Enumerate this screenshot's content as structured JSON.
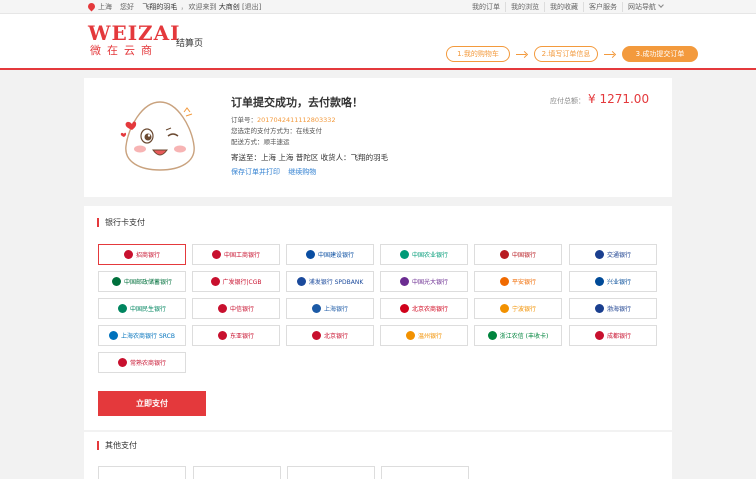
{
  "topbar": {
    "location": "上海",
    "greeting": "您好",
    "username": "飞翔的羽毛",
    "welcome_prefix": "欢迎来到",
    "site_name": "大商创",
    "logout": "[退出]",
    "links": [
      "我的订单",
      "我的浏览",
      "我的收藏",
      "客户服务",
      "网站导航"
    ]
  },
  "header": {
    "logo_en": "WEIZAI",
    "logo_cn": "微在云商",
    "page_name": "结算页",
    "steps": [
      "1.我的购物车",
      "2.填写订单信息",
      "3.成功提交订单"
    ],
    "active_step": 2
  },
  "summary": {
    "title": "订单提交成功，去付款咯！",
    "order_no_label": "订单号：",
    "order_no": "2017042411112803332",
    "pay_method": "您选定的支付方式为：在线支付",
    "ship_method": "配送方式：顺丰速运",
    "address": "寄送至：上海 上海 普陀区  收货人：飞翔的羽毛",
    "link_print": "保存订单并打印",
    "link_continue": "继续购物",
    "total_label": "应付总额：",
    "total_value": "¥ 1271.00"
  },
  "bank_section": {
    "title": "银行卡支付",
    "pay_button": "立即支付",
    "banks": [
      {
        "name": "招商银行",
        "color": "#c8102e"
      },
      {
        "name": "中国工商银行",
        "color": "#c8102e"
      },
      {
        "name": "中国建设银行",
        "color": "#0a4ea2"
      },
      {
        "name": "中国农业银行",
        "color": "#009b77"
      },
      {
        "name": "中国银行",
        "color": "#b81c22"
      },
      {
        "name": "交通银行",
        "color": "#1a3f8f"
      },
      {
        "name": "中国邮政储蓄银行",
        "color": "#00703c"
      },
      {
        "name": "广发银行|CGB",
        "color": "#c8102e"
      },
      {
        "name": "浦发银行 SPDBANK",
        "color": "#1b4a9c"
      },
      {
        "name": "中国光大银行",
        "color": "#6b2c91"
      },
      {
        "name": "平安银行",
        "color": "#f06a00"
      },
      {
        "name": "兴业银行",
        "color": "#004a98"
      },
      {
        "name": "中国民生银行",
        "color": "#00855f"
      },
      {
        "name": "中信银行",
        "color": "#c8102e"
      },
      {
        "name": "上海银行",
        "color": "#1c5aa6"
      },
      {
        "name": "北京农商银行",
        "color": "#d0021b"
      },
      {
        "name": "宁波银行",
        "color": "#f29100"
      },
      {
        "name": "渤海银行",
        "color": "#1a3f8f"
      },
      {
        "name": "上海农商银行 SRCB",
        "color": "#0072bc"
      },
      {
        "name": "东亚银行",
        "color": "#c8102e"
      },
      {
        "name": "北京银行",
        "color": "#c8102e"
      },
      {
        "name": "温州银行",
        "color": "#f29100"
      },
      {
        "name": "浙江农信 (丰收卡)",
        "color": "#00843d"
      },
      {
        "name": "成都银行",
        "color": "#c8102e"
      },
      {
        "name": "常熟农商银行",
        "color": "#c8102e"
      }
    ]
  },
  "other_section": {
    "title": "其他支付"
  },
  "colors": {
    "brand_red": "#e4393c",
    "step_orange": "#f39a3d",
    "link_blue": "#2f7fd1"
  }
}
